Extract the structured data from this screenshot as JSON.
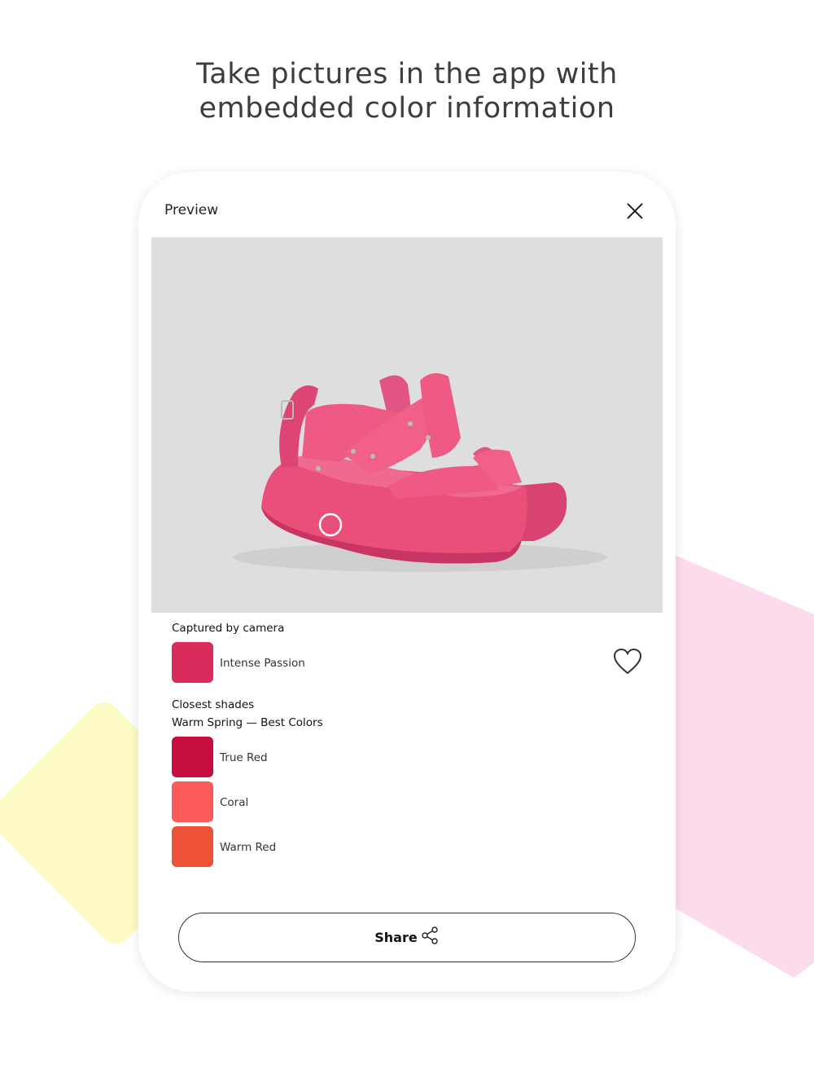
{
  "headline": {
    "line1": "Take pictures in the app with",
    "line2": "embedded color information"
  },
  "preview": {
    "title": "Preview",
    "close_icon": "close-icon"
  },
  "captured": {
    "heading": "Captured by camera",
    "color_name": "Intense Passion",
    "color_hex": "#d92b5c",
    "favorite_icon": "heart-icon"
  },
  "closest": {
    "heading": "Closest shades",
    "palette": "Warm Spring — Best Colors",
    "shades": [
      {
        "name": "True Red",
        "hex": "#c50d3e"
      },
      {
        "name": "Coral",
        "hex": "#fc5a5a"
      },
      {
        "name": "Warm Red",
        "hex": "#ed5136"
      }
    ]
  },
  "share": {
    "label": "Share",
    "icon": "share-icon"
  },
  "colors": {
    "sandal": "#e94f78",
    "photo_background": "#dedede",
    "deco_yellow": "#fdfac4",
    "deco_pink": "#fcdcec"
  }
}
